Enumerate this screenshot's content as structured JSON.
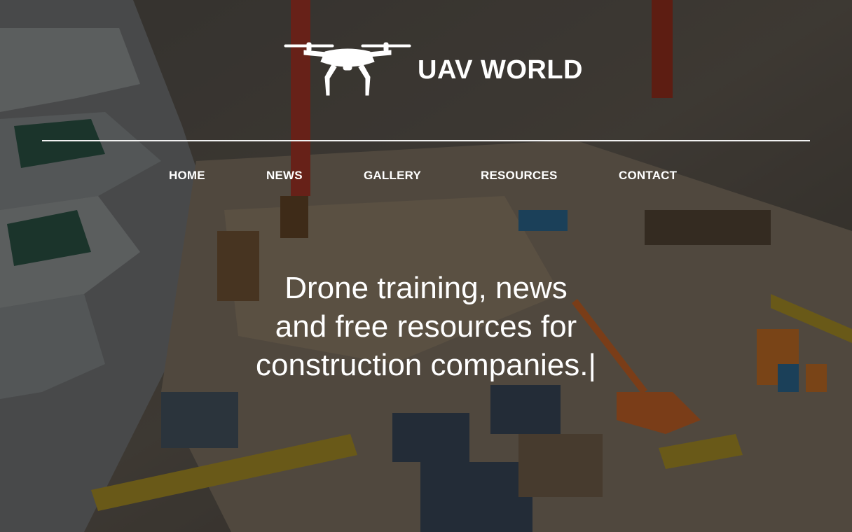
{
  "site": {
    "brand_name": "UAV WORLD",
    "logo_icon": "drone-icon"
  },
  "nav": {
    "items": [
      {
        "label": "HOME"
      },
      {
        "label": "NEWS"
      },
      {
        "label": "GALLERY"
      },
      {
        "label": "RESOURCES"
      },
      {
        "label": "CONTACT"
      }
    ]
  },
  "hero": {
    "lines": [
      "Drone training, news",
      "and free resources for",
      "construction companies."
    ],
    "cursor": "|"
  },
  "colors": {
    "text": "#ffffff",
    "overlay": "#000000"
  }
}
